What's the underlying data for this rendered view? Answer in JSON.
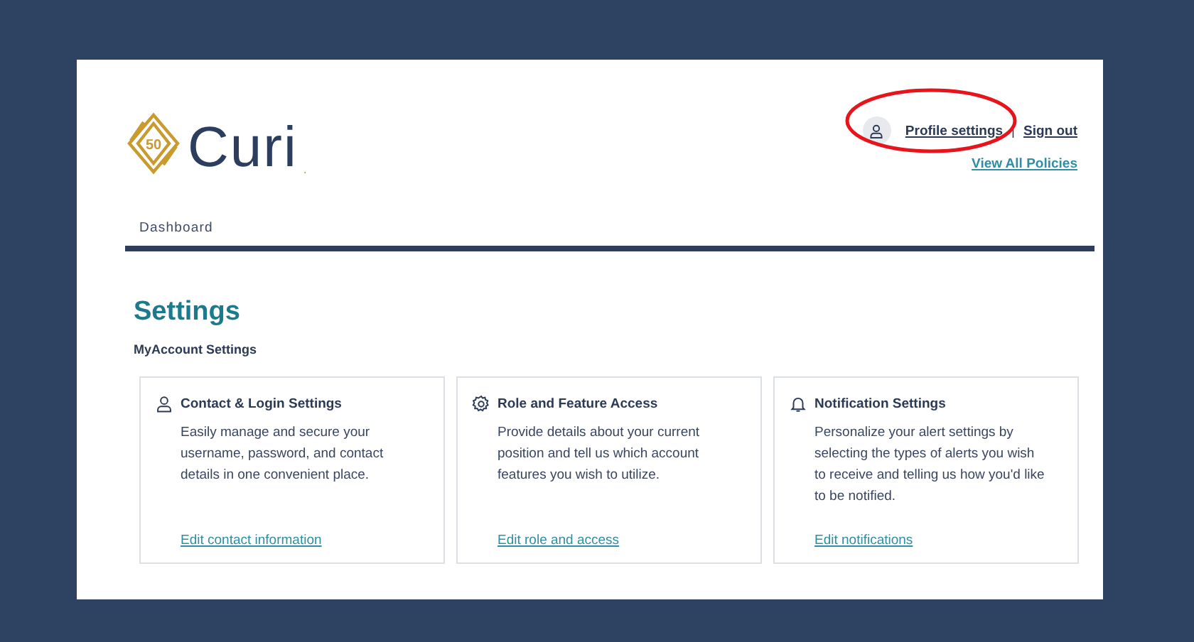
{
  "header": {
    "logo": {
      "badge": "50",
      "wordmark": "Curi",
      "mark": "."
    },
    "user_links": [
      "Profile settings",
      "Sign out"
    ],
    "separator": "|",
    "policies_link": "View All Policies",
    "annotation": {
      "kind": "ellipse"
    }
  },
  "nav": {
    "tabs": [
      {
        "label": "Dashboard",
        "selected": false
      }
    ]
  },
  "page": {
    "title": "Settings",
    "subtitle": "MyAccount Settings"
  },
  "cards": [
    {
      "kind": "person",
      "title": "Contact & Login Settings",
      "text": "Easily manage and secure your username, password, and contact details in one convenient place.",
      "link": "Edit contact information"
    },
    {
      "kind": "gear",
      "title": "Role and Feature Access",
      "text": "Provide details about your current position and tell us which account features you wish to utilize.",
      "link": "Edit role and access"
    },
    {
      "kind": "bell",
      "title": "Notification Settings",
      "text": "Personalize your alert settings by selecting the types of alerts you wish to receive and telling us how you'd like to be notified.",
      "link": "Edit notifications"
    }
  ]
}
